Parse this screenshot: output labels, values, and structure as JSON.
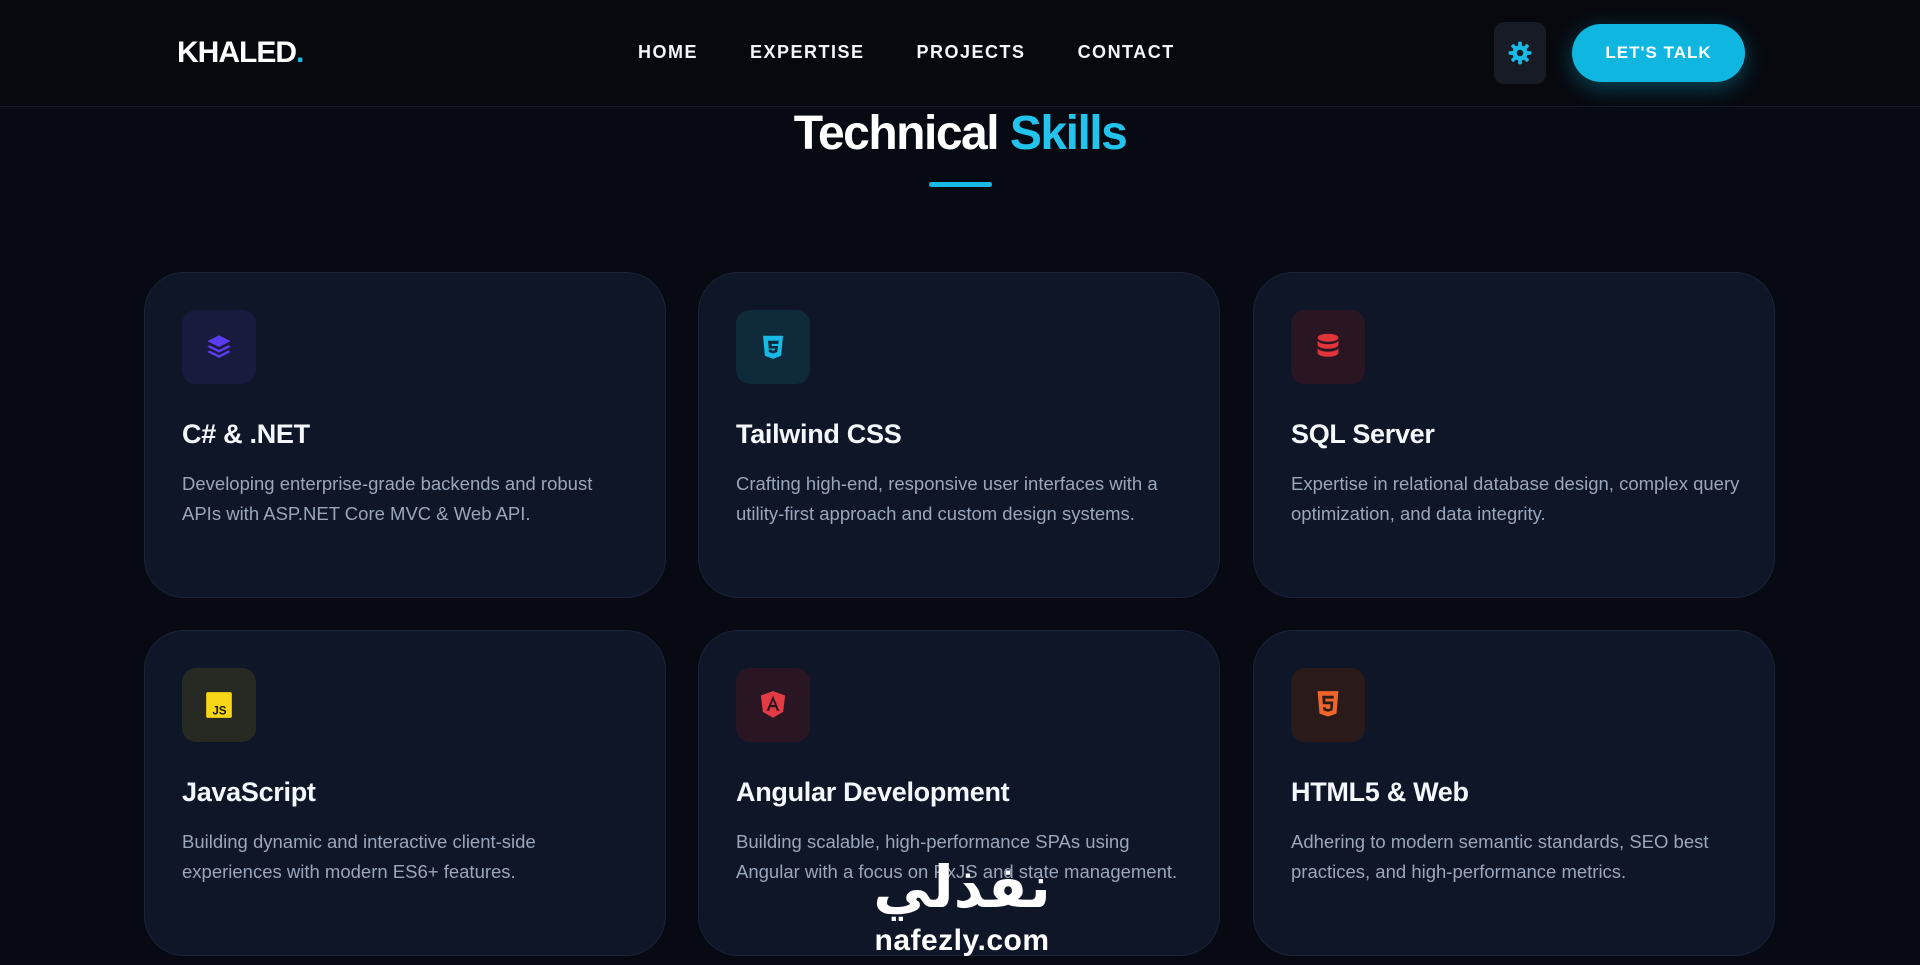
{
  "header": {
    "logo_text": "KHALED",
    "logo_dot": ".",
    "nav": [
      "HOME",
      "EXPERTISE",
      "PROJECTS",
      "CONTACT"
    ],
    "theme_icon": "gear-icon",
    "cta_label": "LET'S TALK"
  },
  "section": {
    "title_main": "Technical",
    "title_accent": "Skills"
  },
  "cards": [
    {
      "title": "C# & .NET",
      "description": "Developing enterprise-grade backends and robust APIs with ASP.NET Core MVC & Web API.",
      "icon": "layers-icon",
      "color": "#5b3df0"
    },
    {
      "title": "Tailwind CSS",
      "description": "Crafting high-end, responsive user interfaces with a utility-first approach and custom design systems.",
      "icon": "css3-icon",
      "color": "#19b9e6"
    },
    {
      "title": "SQL Server",
      "description": "Expertise in relational database design, complex query optimization, and data integrity.",
      "icon": "database-icon",
      "color": "#e0343a"
    },
    {
      "title": "JavaScript",
      "description": "Building dynamic and interactive client-side experiences with modern ES6+ features.",
      "icon": "javascript-icon",
      "color": "#f7d617"
    },
    {
      "title": "Angular Development",
      "description": "Building scalable, high-performance SPAs using Angular with a focus on RxJS and state management.",
      "icon": "angular-icon",
      "color": "#e23b43"
    },
    {
      "title": "HTML5 & Web",
      "description": "Adhering to modern semantic standards, SEO best practices, and high-performance metrics.",
      "icon": "html5-icon",
      "color": "#f06529"
    }
  ],
  "watermark": {
    "arabic": "نفذلي",
    "latin": "nafezly.com"
  },
  "colors": {
    "accent": "#19b9e6",
    "background": "#070a12",
    "card": "#0e1628"
  }
}
